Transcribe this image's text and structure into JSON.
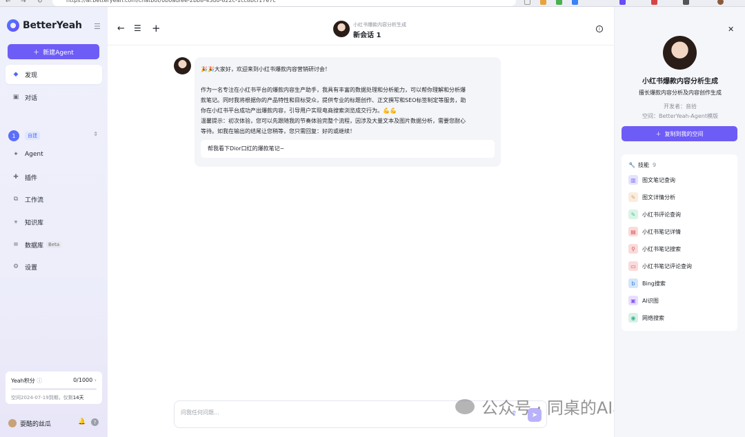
{
  "browser": {
    "url": "https://ai.betteryeah.com/chatbot/0b0adfee-2bb8-43d0-822c-1cc8bcf17e7c",
    "ext_colors": [
      "#e8a33d",
      "#4caf50",
      "#3b82f6",
      "#6a4cf5",
      "#d64545",
      "#555555",
      "#8b5a3c"
    ]
  },
  "sidebar": {
    "brand": "BetterYeah",
    "new_agent": "新建Agent",
    "top_items": [
      {
        "label": "发现"
      },
      {
        "label": "对话"
      }
    ],
    "workspace": {
      "number": "1",
      "badge": "自建"
    },
    "items": [
      {
        "label": "Agent"
      },
      {
        "label": "插件"
      },
      {
        "label": "工作流"
      },
      {
        "label": "知识库"
      },
      {
        "label": "数据库",
        "badge": "Beta"
      },
      {
        "label": "设置"
      }
    ],
    "points": {
      "label": "Yeah积分",
      "value": "0/1000",
      "expire_prefix": "空间2024-07-19到期，仅剩",
      "expire_days": "14天"
    },
    "user": {
      "name": "耍酷的丝瓜"
    }
  },
  "chat": {
    "header": {
      "subtitle": "小红书爆款内容分析生成",
      "title": "新会话 1"
    },
    "message": {
      "lines": [
        "🎉🎉大家好，欢迎来到小红书爆款内容营销研讨会！",
        "",
        "作为一名专注在小红书平台的爆款内容生产助手，我具有丰富的数据处理和分析能力，可以帮你理解和分析爆",
        "款笔记。同时我将根据你的产品特性和目标受众，提供专业的标题创作、正文撰写和SEO标签制定等服务，助",
        "你在小红书平台成功产出爆款内容，引导用户实现电商搜索浏览成交行为。💪💪",
        "温馨提示：初次体验，您可以先跟随我的节奏体验完整个流程，因涉及大量文本及图片数据分析，需要您耐心",
        "等待。如我在输出的结尾让您稍等，您只需回复：好的或继续！"
      ],
      "suggestion": "帮我看下Dior口红的爆款笔记~"
    },
    "input": {
      "placeholder": "问我任何问题..."
    },
    "watermark": "公众号 · 同桌的AI小纸条"
  },
  "panel": {
    "name": "小红书爆款内容分析生成",
    "desc": "擅长爆款内容分析及内容创作生成",
    "developer": "开发者：音拾",
    "space": "空间：BetterYeah-Agent模版",
    "copy_button": "复制到我的空间",
    "skills_label": "技能",
    "skills_count": "9",
    "skills": [
      {
        "label": "图文笔记查询",
        "icon": "chart-icon",
        "color": "#7b6cf6"
      },
      {
        "label": "图文详情分析",
        "icon": "pencil-icon",
        "color": "#e6a15a"
      },
      {
        "label": "小红书评论查询",
        "icon": "note-icon",
        "color": "#4cc38a"
      },
      {
        "label": "小红书笔记详情",
        "icon": "doc-icon",
        "color": "#e54d4d"
      },
      {
        "label": "小红书笔记搜索",
        "icon": "search-icon",
        "color": "#e54d4d"
      },
      {
        "label": "小红书笔记评论查询",
        "icon": "comment-icon",
        "color": "#e54d4d"
      },
      {
        "label": "Bing搜索",
        "icon": "bing-icon",
        "color": "#2b7fe0"
      },
      {
        "label": "AI识图",
        "icon": "image-icon",
        "color": "#8a5cf6"
      },
      {
        "label": "网络搜索",
        "icon": "globe-icon",
        "color": "#3fb68b"
      }
    ]
  }
}
